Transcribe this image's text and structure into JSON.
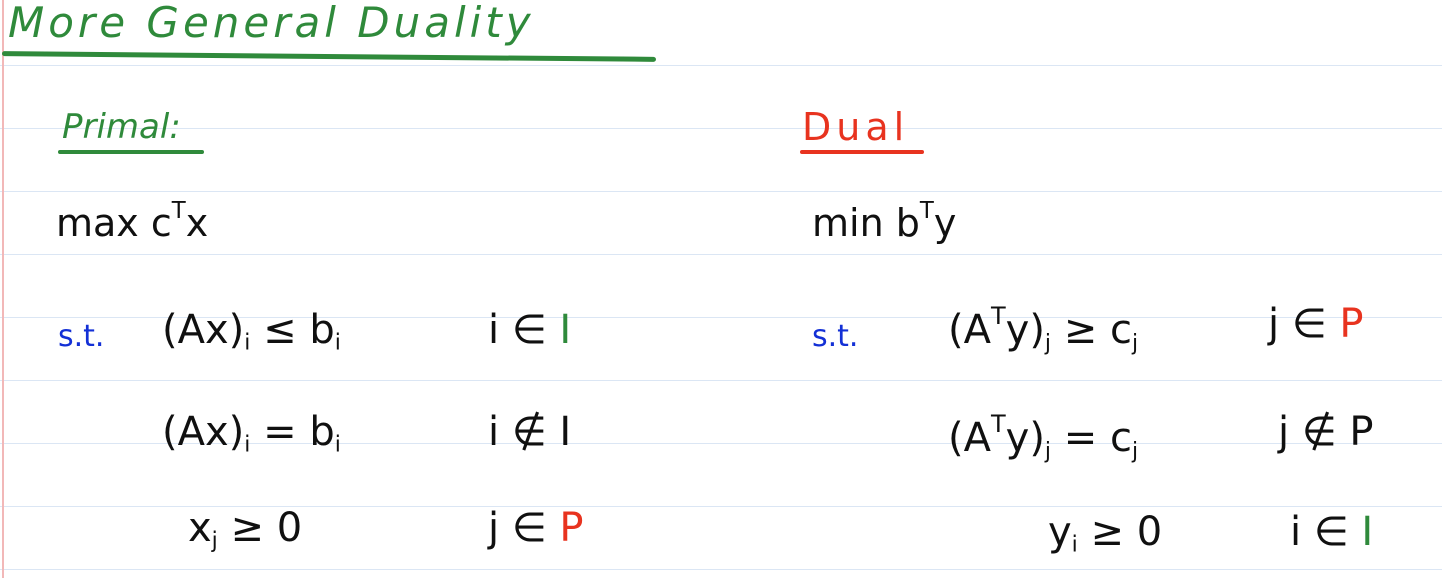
{
  "title": "More General Duality",
  "primal": {
    "label": "Primal:",
    "objective": {
      "op": "max",
      "var": "c",
      "sup": "T",
      "tail": "x"
    },
    "st": "s.t.",
    "constraints": [
      {
        "lhs": "(Ax)",
        "idx": "i",
        "rel": "≤",
        "rhs": "b",
        "rhs_idx": "i",
        "cond": "i ∈",
        "set": "I"
      },
      {
        "lhs": "(Ax)",
        "idx": "i",
        "rel": "=",
        "rhs": "b",
        "rhs_idx": "i",
        "cond": "i ∉",
        "set": "I"
      },
      {
        "lhs": "x",
        "idx": "j",
        "rel": "≥",
        "rhs": "0",
        "rhs_idx": "",
        "cond": "j ∈",
        "set": "P"
      }
    ]
  },
  "dual": {
    "label": "Dual",
    "objective": {
      "op": "min",
      "var": "b",
      "sup": "T",
      "tail": "y"
    },
    "st": "s.t.",
    "constraints": [
      {
        "lhs_pre": "(A",
        "lhs_sup": "T",
        "lhs_post": "y)",
        "idx": "j",
        "rel": "≥",
        "rhs": "c",
        "rhs_idx": "j",
        "cond": "j ∈",
        "set": "P"
      },
      {
        "lhs_pre": "(A",
        "lhs_sup": "T",
        "lhs_post": "y)",
        "idx": "j",
        "rel": "=",
        "rhs": "c",
        "rhs_idx": "j",
        "cond": "j ∉",
        "set": "P"
      },
      {
        "lhs": "y",
        "idx": "i",
        "rel": "≥",
        "rhs": "0",
        "rhs_idx": "",
        "cond": "i ∈",
        "set": "I"
      }
    ]
  },
  "colors": {
    "green": "#2f8a3b",
    "red": "#e8331f",
    "blue": "#1330d6",
    "ink": "#101010"
  }
}
